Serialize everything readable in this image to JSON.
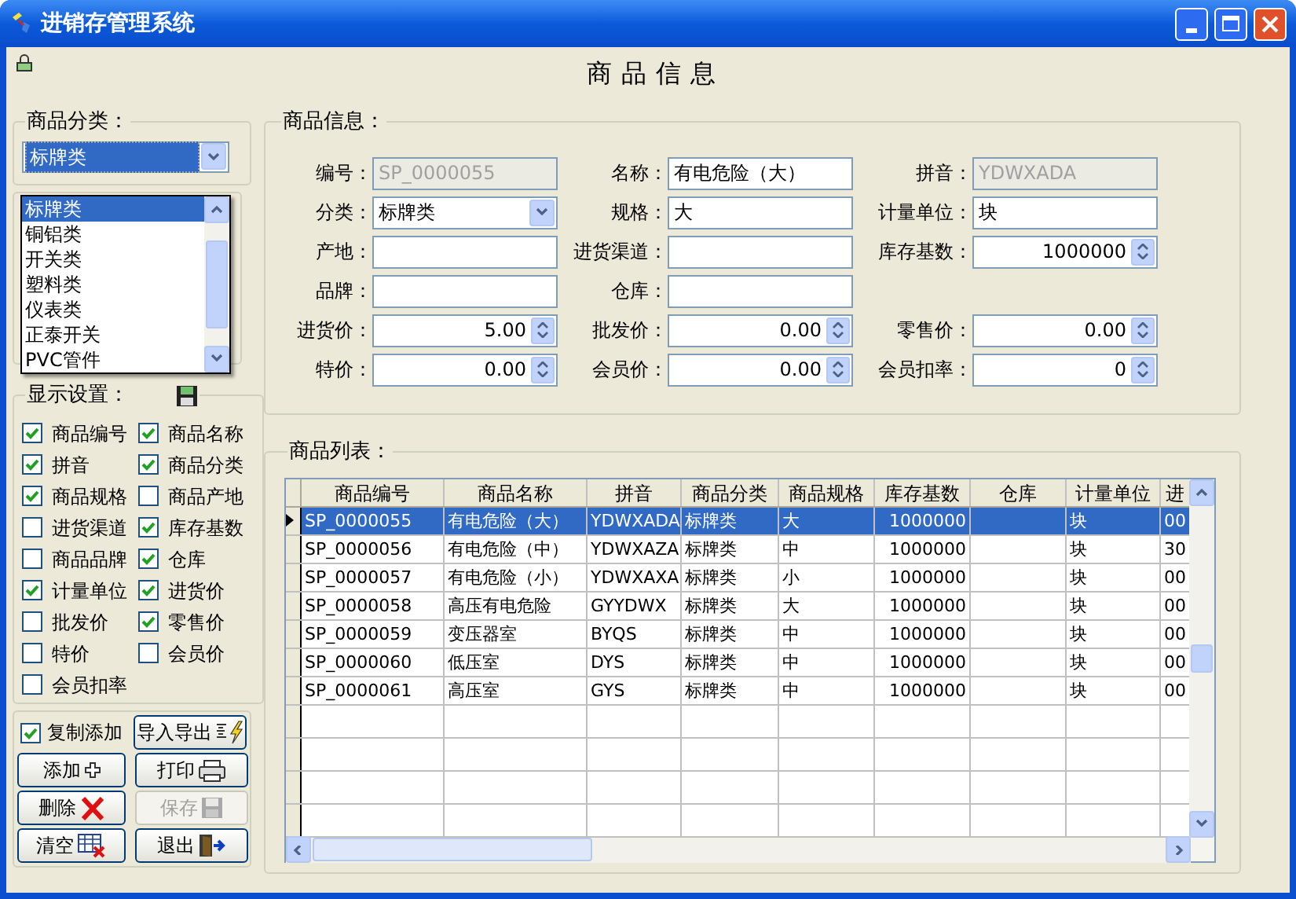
{
  "window": {
    "title": "进销存管理系统"
  },
  "page_title": "商品信息",
  "category": {
    "title": "商品分类：",
    "value": "标牌类",
    "options": [
      {
        "label": "标牌类",
        "selected": true
      },
      {
        "label": "铜铝类",
        "selected": false
      },
      {
        "label": "开关类",
        "selected": false
      },
      {
        "label": "塑料类",
        "selected": false
      },
      {
        "label": "仪表类",
        "selected": false
      },
      {
        "label": "正泰开关",
        "selected": false
      },
      {
        "label": "PVC管件",
        "selected": false
      }
    ]
  },
  "display_settings": {
    "title": "显示设置：",
    "items": [
      {
        "label": "商品编号",
        "checked": true
      },
      {
        "label": "商品名称",
        "checked": true
      },
      {
        "label": "拼音",
        "checked": true
      },
      {
        "label": "商品分类",
        "checked": true
      },
      {
        "label": "商品规格",
        "checked": true
      },
      {
        "label": "商品产地",
        "checked": false
      },
      {
        "label": "进货渠道",
        "checked": false
      },
      {
        "label": "库存基数",
        "checked": true
      },
      {
        "label": "商品品牌",
        "checked": false
      },
      {
        "label": "仓库",
        "checked": true
      },
      {
        "label": "计量单位",
        "checked": true
      },
      {
        "label": "进货价",
        "checked": true
      },
      {
        "label": "批发价",
        "checked": false
      },
      {
        "label": "零售价",
        "checked": true
      },
      {
        "label": "特价",
        "checked": false
      },
      {
        "label": "会员价",
        "checked": false
      },
      {
        "label": "会员扣率",
        "checked": false
      }
    ]
  },
  "copy_add": {
    "label": "复制添加",
    "checked": true
  },
  "buttons": [
    {
      "label": "导入导出",
      "kind": "import",
      "disabled": false
    },
    {
      "label": "添加",
      "kind": "add",
      "disabled": false
    },
    {
      "label": "打印",
      "kind": "print",
      "disabled": false
    },
    {
      "label": "删除",
      "kind": "delete",
      "disabled": false
    },
    {
      "label": "保存",
      "kind": "save",
      "disabled": true
    },
    {
      "label": "清空",
      "kind": "clear",
      "disabled": false
    },
    {
      "label": "退出",
      "kind": "exit",
      "disabled": false
    }
  ],
  "product_info": {
    "title": "商品信息：",
    "rows": [
      [
        {
          "label": "编号：",
          "kind": "readonly",
          "value": "SP_0000055"
        },
        {
          "label": "名称：",
          "kind": "text",
          "value": "有电危险（大）"
        },
        {
          "label": "拼音：",
          "kind": "readonly",
          "value": "YDWXADA"
        }
      ],
      [
        {
          "label": "分类：",
          "kind": "combo",
          "value": "标牌类"
        },
        {
          "label": "规格：",
          "kind": "text",
          "value": "大"
        },
        {
          "label": "计量单位：",
          "kind": "text",
          "value": "块"
        }
      ],
      [
        {
          "label": "产地：",
          "kind": "text"
        },
        {
          "label": "进货渠道：",
          "kind": "text"
        },
        {
          "label": "库存基数：",
          "kind": "spin",
          "value": "1000000"
        }
      ],
      [
        {
          "label": "品牌：",
          "kind": "text"
        },
        {
          "label": "仓库：",
          "kind": "text"
        }
      ],
      [
        {
          "label": "进货价：",
          "kind": "spin",
          "value": "5.00"
        },
        {
          "label": "批发价：",
          "kind": "spin",
          "value": "0.00"
        },
        {
          "label": "零售价：",
          "kind": "spin",
          "value": "0.00"
        }
      ],
      [
        {
          "label": "特价：",
          "kind": "spin",
          "value": "0.00"
        },
        {
          "label": "会员价：",
          "kind": "spin",
          "value": "0.00"
        },
        {
          "label": "会员扣率：",
          "kind": "spin",
          "value": "0"
        }
      ]
    ]
  },
  "product_list": {
    "title": "商品列表：",
    "columns": [
      "商品编号",
      "商品名称",
      "拼音",
      "商品分类",
      "商品规格",
      "库存基数",
      "仓库",
      "计量单位",
      "进"
    ],
    "rows": [
      {
        "selected": true,
        "cells": [
          "SP_0000055",
          "有电危险（大）",
          "YDWXADA",
          "标牌类",
          "大",
          "1000000",
          "",
          "块",
          "00"
        ]
      },
      {
        "selected": false,
        "cells": [
          "SP_0000056",
          "有电危险（中）",
          "YDWXAZA",
          "标牌类",
          "中",
          "1000000",
          "",
          "块",
          "30"
        ]
      },
      {
        "selected": false,
        "cells": [
          "SP_0000057",
          "有电危险（小）",
          "YDWXAXA",
          "标牌类",
          "小",
          "1000000",
          "",
          "块",
          "00"
        ]
      },
      {
        "selected": false,
        "cells": [
          "SP_0000058",
          "高压有电危险",
          "GYYDWX",
          "标牌类",
          "大",
          "1000000",
          "",
          "块",
          "00"
        ]
      },
      {
        "selected": false,
        "cells": [
          "SP_0000059",
          "变压器室",
          "BYQS",
          "标牌类",
          "中",
          "1000000",
          "",
          "块",
          "00"
        ]
      },
      {
        "selected": false,
        "cells": [
          "SP_0000060",
          "低压室",
          "DYS",
          "标牌类",
          "中",
          "1000000",
          "",
          "块",
          "00"
        ]
      },
      {
        "selected": false,
        "cells": [
          "SP_0000061",
          "高压室",
          "GYS",
          "标牌类",
          "中",
          "1000000",
          "",
          "块",
          "00"
        ]
      }
    ]
  }
}
